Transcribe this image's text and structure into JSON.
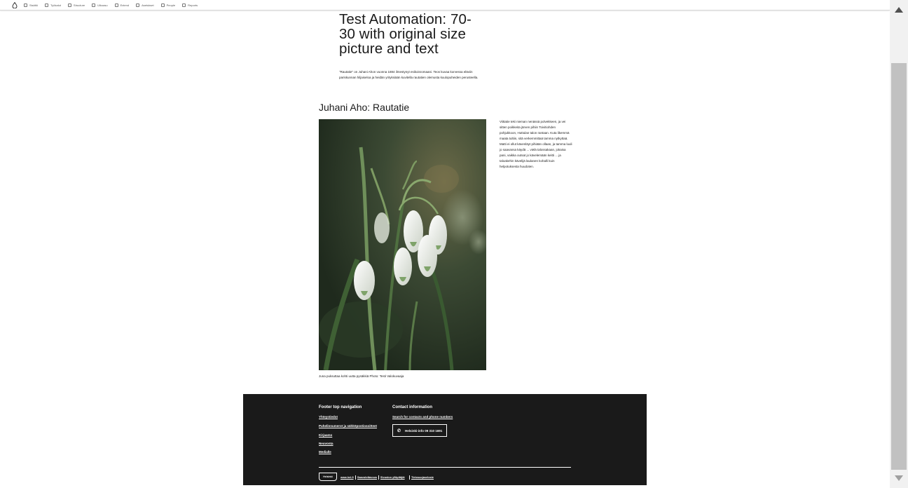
{
  "toolbar": {
    "items": [
      {
        "label": "Sisältö",
        "icon": "content-icon"
      },
      {
        "label": "Työkalut",
        "icon": "tools-icon"
      },
      {
        "label": "Structure",
        "icon": "structure-icon"
      },
      {
        "label": "Ulkoasu",
        "icon": "appearance-icon"
      },
      {
        "label": "Extend",
        "icon": "extend-icon"
      },
      {
        "label": "Asetukset",
        "icon": "config-icon"
      },
      {
        "label": "People",
        "icon": "people-icon"
      },
      {
        "label": "Reports",
        "icon": "reports-icon"
      }
    ]
  },
  "hero": {
    "title": "Test Automation: 70-30 with original size picture and text",
    "lead": "\"Rautatie\" on Juhani Ahon vuonna 1884 ilmestynyt esikoisromaani. Teos kuvaa korvessa eläviin pariskunnan hiljaiseloa ja heidän yrityksiään kuvitella rautatien olemusta kuulopuheiden perusteella."
  },
  "section": {
    "title": "Juhani Aho: Rautatie",
    "side_text": "Viittatie teki nieman nenässä polvekkeen, ja vei sitten poikkeita järven pihiin Toivitiohden pohjukkoon, Huttulan talon rantaan. Kuta likemmä maata tultiin, sitä verkemmittaä tamma nytkyttaä. Matti ei ollut kävenläyt pihiään ollaan, ja tamma luuli jo saavansa käydä ... vielä talossakaan, jokaisa pani, vaikka outsat jo kävelemään keitti ... ja taloakehin kävelijä laulanen kohalli kuin helpotuksesta huudoten.",
    "caption": "Juna puksuttaa kohti uutta pysäkkiä Photo: Testi Valokuvaaja"
  },
  "footer": {
    "nav_title": "Footer top navigation",
    "nav_links": [
      "Yhteystiedot",
      "Puhelinnumerot ja sähköpostiosoitteet",
      "Kirjaamo",
      "Neuvonta",
      "Medialle"
    ],
    "contact_title": "Contact information",
    "contact_link": "Search for contacts and phone numbers",
    "phone": "Helsinki-info 09 310 1691",
    "logo": "Helsinki",
    "bottom_links": [
      "www.hel.fi",
      "Saavutettavuus",
      "Sivuston ylläpitäjät",
      "Tietosuojaseloste"
    ]
  },
  "colors": {
    "footer_bg": "#1a1a1a",
    "scroll_thumb": "#c1c1c1"
  }
}
